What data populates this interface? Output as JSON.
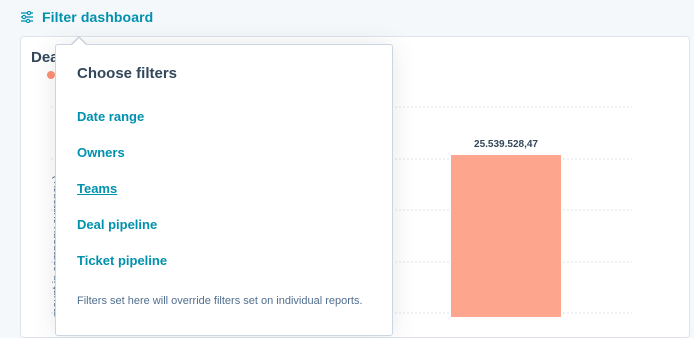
{
  "toolbar": {
    "filter_label": "Filter dashboard",
    "filter_icon": "sliders-icon"
  },
  "report": {
    "title": "Dea",
    "y_axis_label": "mount in company currency )",
    "bar_value_label": "25.539.528,47",
    "legend_color": "#ff8f73",
    "bar_color": "#fea58e"
  },
  "popover": {
    "title": "Choose filters",
    "items": [
      {
        "label": "Date range"
      },
      {
        "label": "Owners"
      },
      {
        "label": "Teams"
      },
      {
        "label": "Deal pipeline"
      },
      {
        "label": "Ticket pipeline"
      }
    ],
    "note": "Filters set here will override filters set on individual reports."
  },
  "colors": {
    "link": "#0091ae",
    "text": "#33475b",
    "gridline": "#dfe3eb"
  }
}
